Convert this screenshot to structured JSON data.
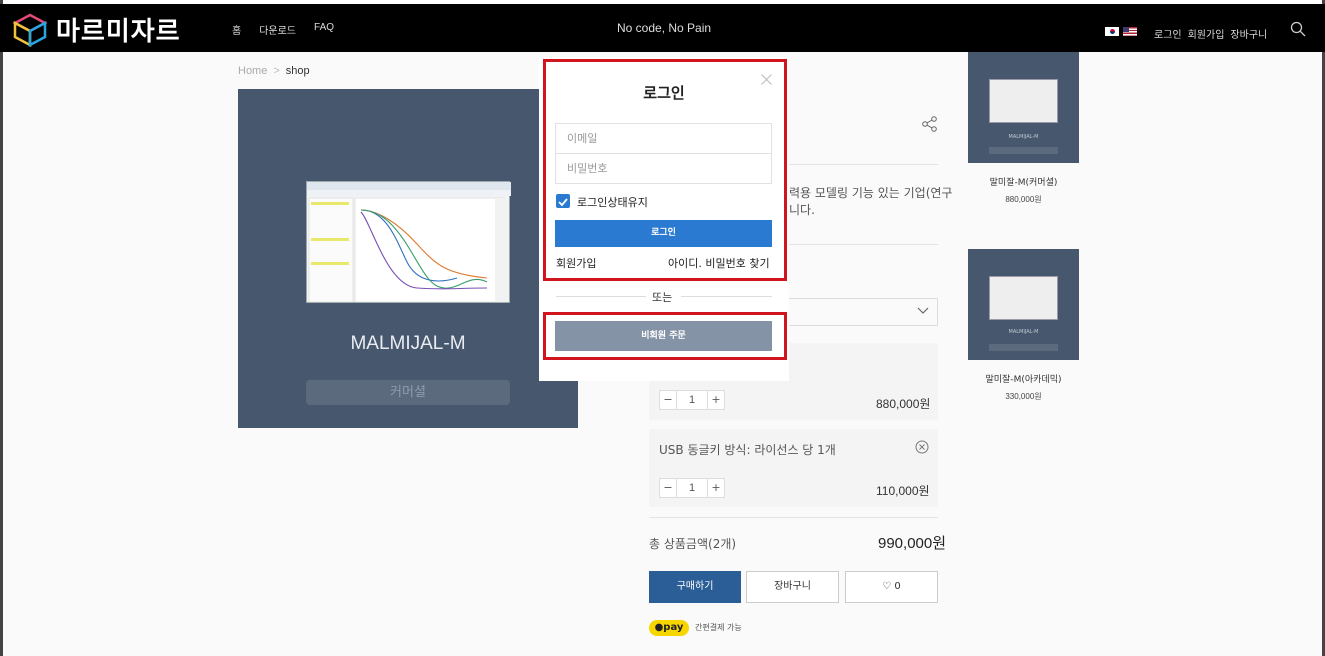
{
  "header": {
    "logo_text": "마르미자르",
    "nav": [
      "홈",
      "다운로드",
      "FAQ"
    ],
    "slogan": "No code, No Pain",
    "user_nav": [
      "로그인",
      "회원가입",
      "장바구니"
    ]
  },
  "breadcrumb": {
    "home": "Home",
    "separator": ">",
    "current": "shop"
  },
  "product": {
    "name": "MALMIJAL-M",
    "tag": "커머셜",
    "description_lines": [
      "력용 모델링 기능 있는 기업(연구",
      "니다."
    ]
  },
  "options": [
    {
      "label": "",
      "qty": "1",
      "price": "880,000원"
    },
    {
      "label": "USB 동글키 방식: 라이선스 당 1개",
      "qty": "1",
      "price": "110,000원"
    }
  ],
  "total": {
    "label": "총 상품금액(2개)",
    "value": "990,000원"
  },
  "actions": {
    "buy": "구매하기",
    "cart": "장바구니",
    "wish_count": "0"
  },
  "kakao_pay": {
    "badge": "pay",
    "text": "간편결제 가능"
  },
  "related": [
    {
      "title": "말미잘-M(커머셜)",
      "price": "880,000원",
      "thumb_label": "MALMIJAL-M"
    },
    {
      "title": "말미잘-M(아카데믹)",
      "price": "330,000원",
      "thumb_label": "MALMIJAL-M"
    }
  ],
  "login_modal": {
    "title": "로그인",
    "email_placeholder": "이메일",
    "password_placeholder": "비밀번호",
    "remember_label": "로그인상태유지",
    "login_button": "로그인",
    "signup_link": "회원가입",
    "find_link": "아이디. 비밀번호 찾기",
    "or_text": "또는",
    "guest_button": "비회원 주문"
  },
  "colors": {
    "accent": "#2b7ad1",
    "header_bg": "#000000",
    "product_bg": "#47576d",
    "highlight": "#d2141e"
  }
}
